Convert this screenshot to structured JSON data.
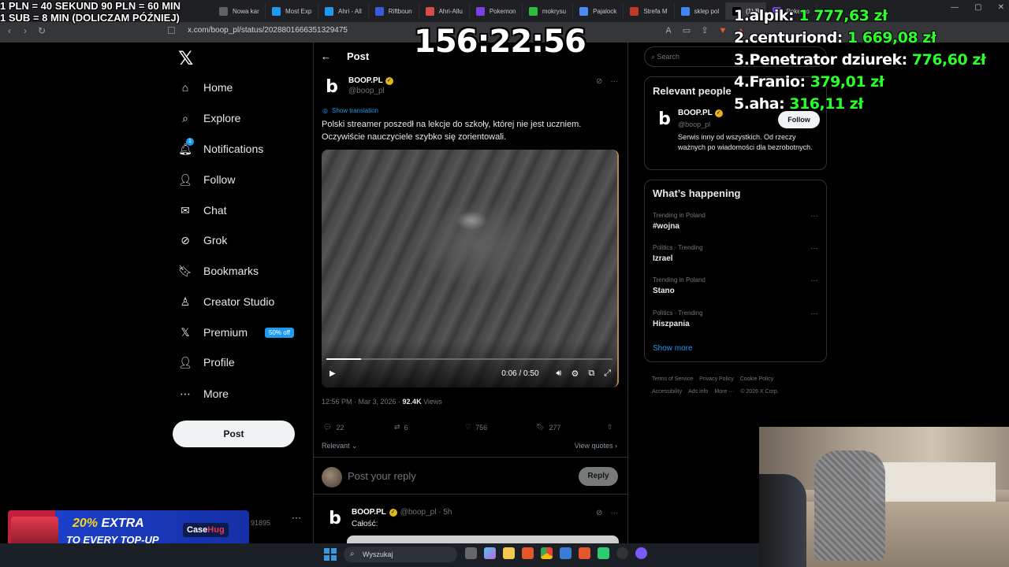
{
  "browser": {
    "tabs": [
      {
        "label": "Nowa kar",
        "color": "#5f6368"
      },
      {
        "label": "Most Exp",
        "color": "#1d9bf0"
      },
      {
        "label": "Ahri - All",
        "color": "#1d9bf0"
      },
      {
        "label": "Riftboun",
        "color": "#3b5bdb"
      },
      {
        "label": "Ahri-Allu",
        "color": "#d94c4c"
      },
      {
        "label": "Pokemon",
        "color": "#7b3fe4"
      },
      {
        "label": "mokrysu",
        "color": "#2dbd3a"
      },
      {
        "label": "Pajalock",
        "color": "#4c8bf5"
      },
      {
        "label": "Strefa M",
        "color": "#c0392b"
      },
      {
        "label": "sklep pol",
        "color": "#4285f4"
      },
      {
        "label": "(1) B",
        "color": "#000000",
        "active": true
      },
      {
        "label": "Pokemo",
        "color": "#7b3fe4"
      }
    ],
    "url": "x.com/boop_pl/status/2028801666351329475",
    "window_controls": [
      "—",
      "▢",
      "✕"
    ]
  },
  "nav": {
    "logo": "𝕏",
    "items": [
      {
        "key": "home",
        "label": "Home",
        "icon": "⌂"
      },
      {
        "key": "explore",
        "label": "Explore",
        "icon": "⌕"
      },
      {
        "key": "notifications",
        "label": "Notifications",
        "icon": "🔔︎"
      },
      {
        "key": "follow",
        "label": "Follow",
        "icon": "👤︎"
      },
      {
        "key": "chat",
        "label": "Chat",
        "icon": "✉"
      },
      {
        "key": "grok",
        "label": "Grok",
        "icon": "⊘"
      },
      {
        "key": "bookmarks",
        "label": "Bookmarks",
        "icon": "🔖︎"
      },
      {
        "key": "creator",
        "label": "Creator Studio",
        "icon": "♙"
      },
      {
        "key": "premium",
        "label": "Premium",
        "icon": "𝕏"
      },
      {
        "key": "profile",
        "label": "Profile",
        "icon": "👤︎"
      },
      {
        "key": "more",
        "label": "More",
        "icon": "⋯"
      }
    ],
    "notifications_badge": "1",
    "premium_badge": "50% off",
    "post_button": "Post",
    "account_handle": "91895",
    "account_more": "···"
  },
  "post": {
    "header_title": "Post",
    "back_icon": "←",
    "author_name": "BOOP.PL",
    "author_handle": "@boop_pl",
    "avatar_letter": "b",
    "verified_icon": "✓",
    "show_translation": "Show translation",
    "text": "Polski streamer poszedł na lekcje do szkoły, której nie jest uczniem. Oczywiście nauczyciele szybko się zorientowali.",
    "video": {
      "time": "0:06 / 0:50",
      "progress": 0.12
    },
    "timestamp": "12:56 PM · Mar 3, 2026 · ",
    "views_count": "92.4K",
    "views_label": " Views",
    "stats": {
      "replies": "22",
      "reposts": "6",
      "likes": "756",
      "bookmarks": "277"
    },
    "relevant": "Relevant ⌄",
    "view_quotes": "View quotes ›",
    "reply_placeholder": "Post your reply",
    "reply_button": "Reply"
  },
  "reply": {
    "author_name": "BOOP.PL",
    "handle_time": "@boop_pl · 5h",
    "text": "Całość:"
  },
  "right": {
    "search_placeholder": "Search",
    "relevant_title": "Relevant people",
    "person": {
      "name": "BOOP.PL",
      "handle": "@boop_pl",
      "follow": "Follow",
      "bio": "Serwis inny od wszystkich. Od rzeczy ważnych po wiadomości dla bezrobotnych."
    },
    "happening_title": "What’s happening",
    "trends": [
      {
        "context": "Trending in Poland",
        "topic": "#wojna"
      },
      {
        "context": "Politics · Trending",
        "topic": "Izrael"
      },
      {
        "context": "Trending in Poland",
        "topic": "Stano"
      },
      {
        "context": "Politics · Trending",
        "topic": "Hiszpania"
      }
    ],
    "show_more": "Show more",
    "footer": {
      "links": [
        "Terms of Service",
        "Privacy Policy",
        "Cookie Policy",
        "Accessibility",
        "Ads info",
        "More ···"
      ],
      "copyright": "© 2026 X Corp."
    }
  },
  "overlay": {
    "rate_line1": "1 PLN =  40 SEKUND 90 PLN = 60 MIN",
    "rate_line2": "1 SUB = 8 MIN (DOLICZAM PÓŹNIEJ)",
    "timer": "156:22:56",
    "leaderboard": [
      {
        "rank": "1.",
        "name": "alpik:",
        "amount": "1 777,63 zł"
      },
      {
        "rank": "2.",
        "name": "centuriond:",
        "amount": "1 669,08 zł"
      },
      {
        "rank": "3.",
        "name": "Penetrator dziurek:",
        "amount": "776,60 zł"
      },
      {
        "rank": "4.",
        "name": "Franio:",
        "amount": "379,01 zł"
      },
      {
        "rank": "5.",
        "name": "aha:",
        "amount": "316,11 zł"
      }
    ],
    "ad": {
      "pct": "20% ",
      "extra": "EXTRA",
      "line2": "TO EVERY TOP-UP",
      "brand_a": "Case",
      "brand_b": "Hug"
    }
  },
  "taskbar": {
    "search": "Wyszukaj"
  },
  "colors": {
    "accent": "#1d9bf0",
    "verified": "#e2b719",
    "donation_green": "#2aff2a",
    "background": "#000000"
  }
}
